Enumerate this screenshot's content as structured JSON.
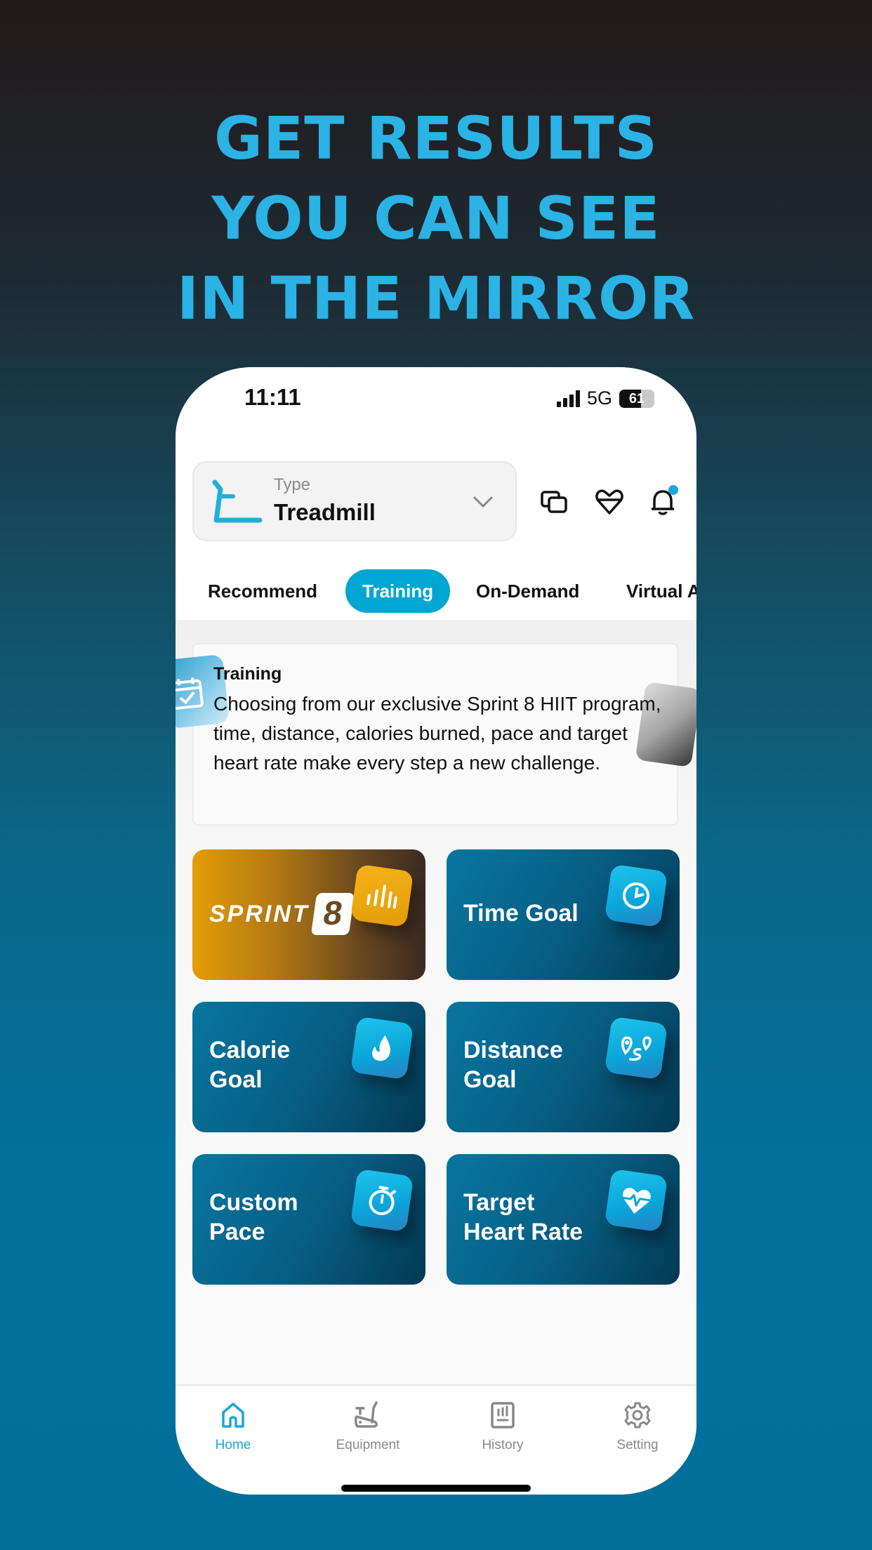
{
  "headline": [
    "GET RESULTS",
    "YOU CAN SEE",
    "IN THE MIRROR"
  ],
  "status_bar": {
    "time": "11:11",
    "network": "5G",
    "battery_percent": 61
  },
  "header": {
    "type_label": "Type",
    "type_value": "Treadmill",
    "icons": [
      "screen-mirror-icon",
      "heart-rate-icon",
      "bell-icon"
    ],
    "has_notification": true
  },
  "tabs": [
    {
      "label": "Recommend",
      "active": false
    },
    {
      "label": "Training",
      "active": true
    },
    {
      "label": "On-Demand",
      "active": false
    },
    {
      "label": "Virtual Active",
      "active": false
    }
  ],
  "info_card": {
    "title": "Training",
    "body": "Choosing from our exclusive Sprint 8 HIIT program, time, distance, calories burned, pace and target heart rate make every step a new challenge."
  },
  "tiles": [
    {
      "id": "sprint8",
      "label": "SPRINT",
      "label_suffix": "8",
      "icon": "bar-chart-icon"
    },
    {
      "id": "time-goal",
      "label": "Time Goal",
      "icon": "clock-icon"
    },
    {
      "id": "calorie-goal",
      "label_lines": [
        "Calorie",
        "Goal"
      ],
      "icon": "flame-icon"
    },
    {
      "id": "distance-goal",
      "label_lines": [
        "Distance",
        "Goal"
      ],
      "icon": "route-icon"
    },
    {
      "id": "custom-pace",
      "label_lines": [
        "Custom",
        "Pace"
      ],
      "icon": "stopwatch-icon"
    },
    {
      "id": "target-heart-rate",
      "label_lines": [
        "Target",
        "Heart Rate"
      ],
      "icon": "heart-pulse-icon"
    }
  ],
  "bottom_nav": [
    {
      "label": "Home",
      "icon": "home-icon",
      "active": true
    },
    {
      "label": "Equipment",
      "icon": "exercise-bike-icon",
      "active": false
    },
    {
      "label": "History",
      "icon": "history-chart-icon",
      "active": false
    },
    {
      "label": "Setting",
      "icon": "gear-icon",
      "active": false
    }
  ],
  "colors": {
    "accent": "#1aa6d6",
    "headline": "#2ab3e4",
    "tile": "#07769f",
    "sprint": "#e49c06"
  }
}
